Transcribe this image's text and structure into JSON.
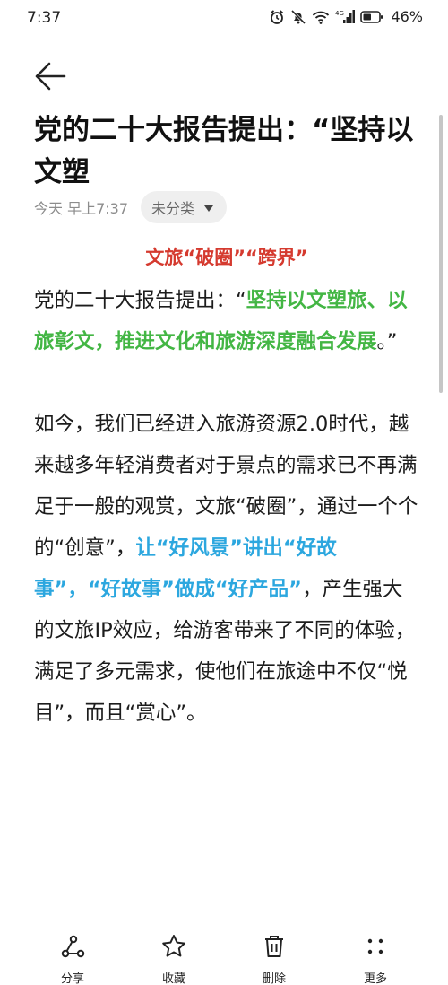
{
  "status_bar": {
    "time": "7:37",
    "network": "4G",
    "battery_percent": "46%",
    "icons": [
      "alarm-icon",
      "mute-icon",
      "wifi-icon",
      "signal-icon",
      "battery-icon"
    ]
  },
  "note": {
    "title": "党的二十大报告提出：“坚持以文塑",
    "date": "今天 早上7:37",
    "category": "未分类",
    "heading": "文旅“破圈”“跨界”",
    "para1_normal_a": "党的二十大报告提出：“",
    "para1_green": "坚持以文塑旅、以旅彰文，推进文化和旅游深度融合发展",
    "para1_normal_b": "。”",
    "para2_normal_a": "如今，我们已经进入旅游资源2.0时代，越来越多年轻消费者对于景点的需求已不再满足于一般的观赏，文旅“破圈”，通过一个个的“创意”，",
    "para2_blue": "让“好风景”讲出“好故事”，“好故事”做成“好产品”",
    "para2_normal_b": "，产生强大的文旅IP效应，给游客带来了不同的体验，满足了多元需求，使他们在旅途中不仅“悦目”，而且“赏心”。"
  },
  "toolbar": {
    "share_label": "分享",
    "favorite_label": "收藏",
    "delete_label": "删除",
    "more_label": "更多"
  },
  "colors": {
    "heading_red": "#d53a2f",
    "highlight_green": "#43b644",
    "highlight_blue": "#2ca7df"
  }
}
